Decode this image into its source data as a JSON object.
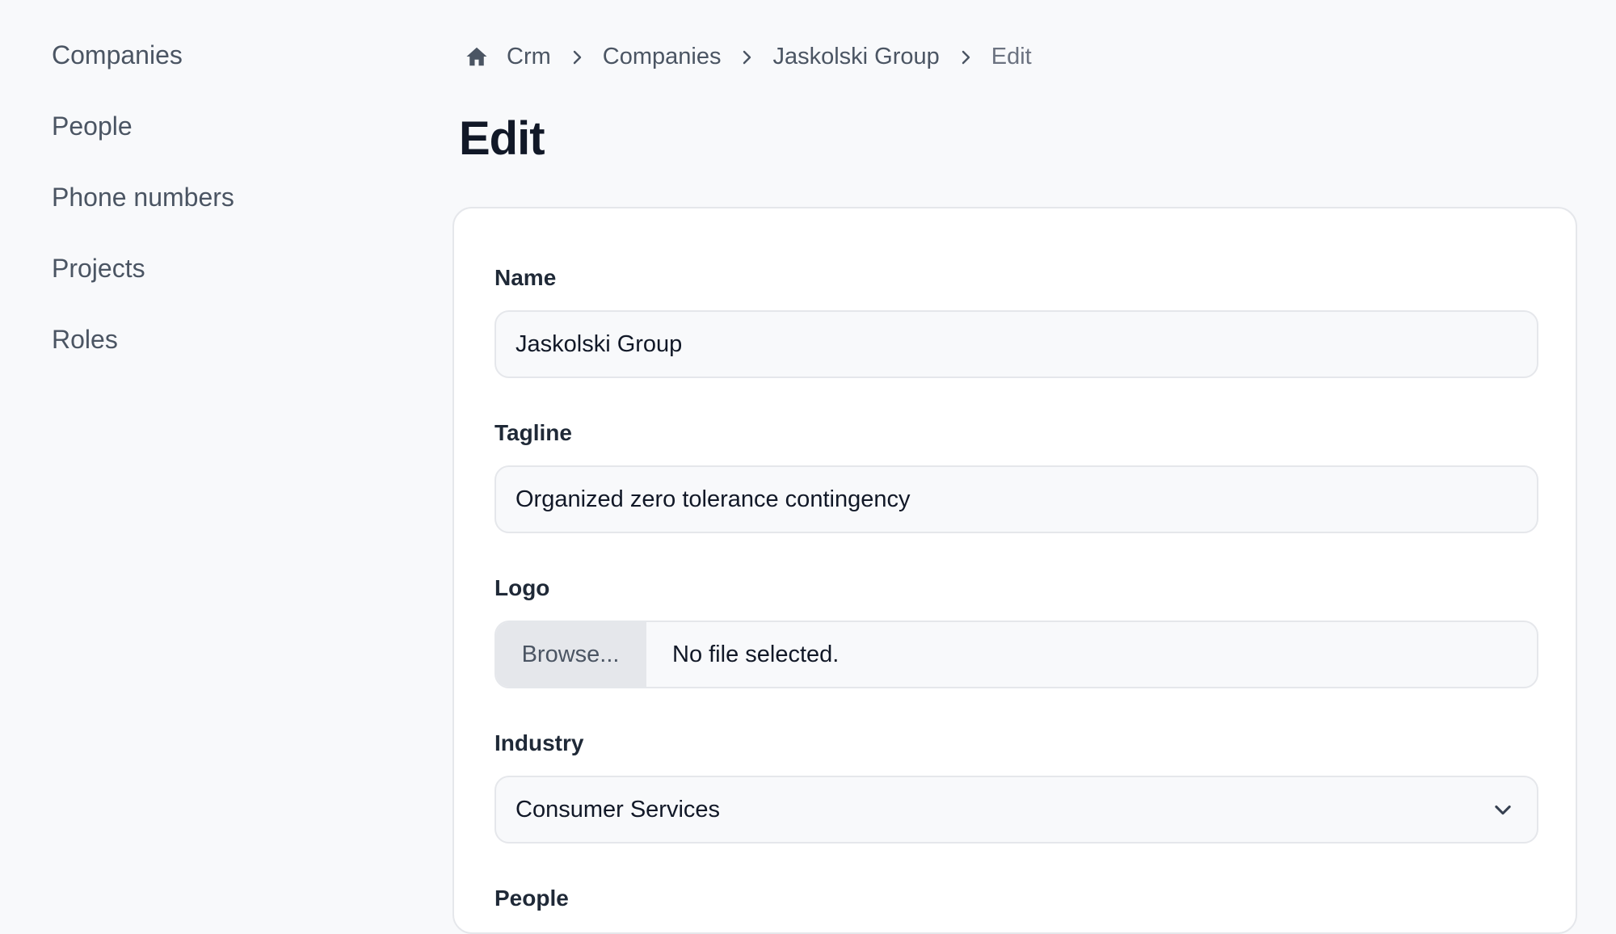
{
  "sidebar": {
    "items": [
      {
        "label": "Companies"
      },
      {
        "label": "People"
      },
      {
        "label": "Phone numbers"
      },
      {
        "label": "Projects"
      },
      {
        "label": "Roles"
      }
    ]
  },
  "breadcrumb": {
    "items": [
      "Crm",
      "Companies",
      "Jaskolski Group",
      "Edit"
    ]
  },
  "page": {
    "title": "Edit"
  },
  "form": {
    "name": {
      "label": "Name",
      "value": "Jaskolski Group"
    },
    "tagline": {
      "label": "Tagline",
      "value": "Organized zero tolerance contingency"
    },
    "logo": {
      "label": "Logo",
      "button_label": "Browse...",
      "status": "No file selected."
    },
    "industry": {
      "label": "Industry",
      "selected": "Consumer Services"
    },
    "people": {
      "label": "People"
    }
  },
  "icons": {
    "home": "home-icon",
    "separator": "chevron-right-icon",
    "select": "chevron-down-icon"
  },
  "colors": {
    "background": "#f8f9fb",
    "card": "#ffffff",
    "border": "#e5e7eb",
    "text": "#1f2937",
    "muted": "#4b5563"
  }
}
